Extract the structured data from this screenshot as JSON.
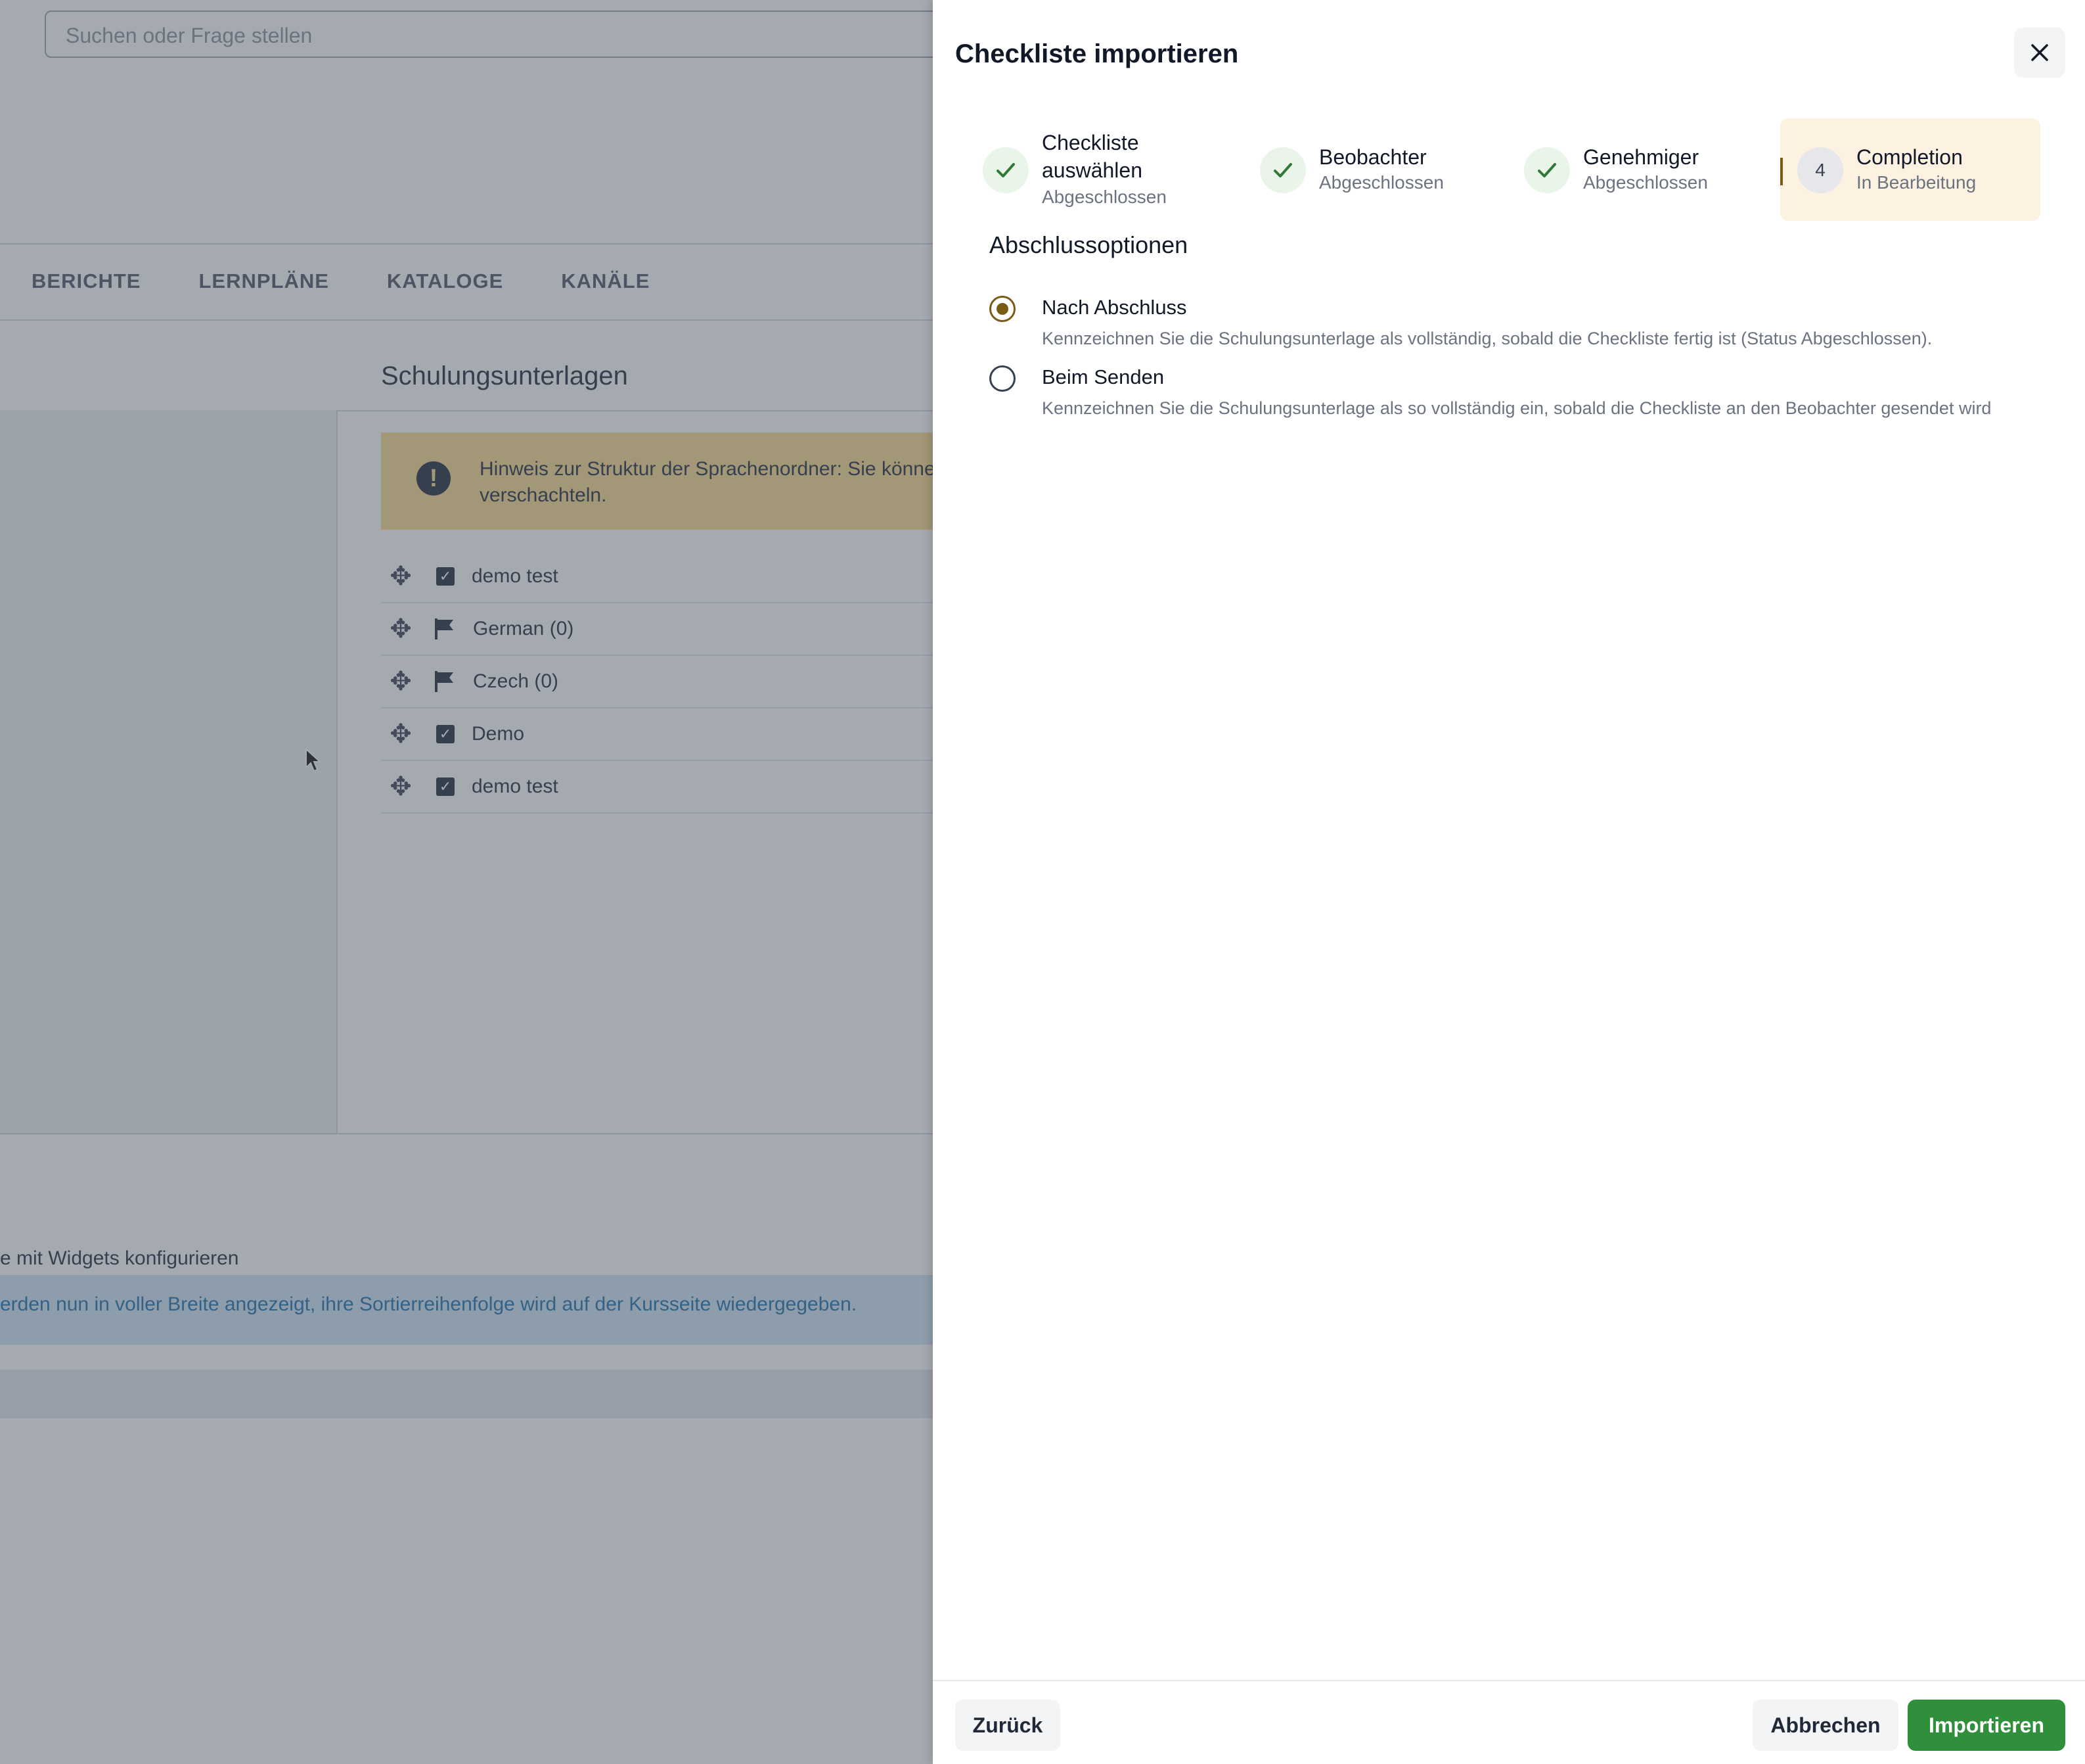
{
  "background": {
    "search_placeholder": "Suchen oder Frage stellen",
    "nav": [
      "BERICHTE",
      "LERNPLÄNE",
      "KATALOGE",
      "KANÄLE"
    ],
    "panel_title": "Schulungsunterlagen",
    "warning_text": "Hinweis zur Struktur der Sprachenordner: Sie können verschachteln.",
    "tree": [
      {
        "label": "demo test",
        "icon": "checklist-icon"
      },
      {
        "label": "German (0)",
        "icon": "flag-icon"
      },
      {
        "label": "Czech (0)",
        "icon": "flag-icon"
      },
      {
        "label": "Demo",
        "icon": "checklist-icon"
      },
      {
        "label": "demo test",
        "icon": "checklist-icon"
      }
    ],
    "widget_text": "e mit Widgets konfigurieren",
    "info_text": "erden nun in voller Breite angezeigt, ihre Sortierreihenfolge wird auf der Kursseite wiedergegeben."
  },
  "drawer": {
    "title": "Checkliste importieren",
    "steps": [
      {
        "name_line1": "Checkliste",
        "name_line2": "auswählen",
        "status": "Abgeschlossen"
      },
      {
        "name": "Beobachter",
        "status": "Abgeschlossen"
      },
      {
        "name": "Genehmiger",
        "status": "Abgeschlossen"
      },
      {
        "number": "4",
        "name": "Completion",
        "status": "In Bearbeitung"
      }
    ],
    "section_title": "Abschlussoptionen",
    "options": [
      {
        "label": "Nach Abschluss",
        "description": "Kennzeichnen Sie die Schulungsunterlage als vollständig, sobald die Checkliste fertig ist (Status Abgeschlossen).",
        "selected": true
      },
      {
        "label": "Beim Senden",
        "description": "Kennzeichnen Sie die Schulungsunterlage als so vollständig ein, sobald die Checkliste an den Beobachter gesendet wird",
        "selected": false
      }
    ],
    "buttons": {
      "back": "Zurück",
      "cancel": "Abbrechen",
      "import": "Importieren"
    }
  },
  "colors": {
    "accent_brown": "#7a5b14",
    "import_green": "#2f8f3a",
    "warning_yellow": "#f9d98b",
    "info_blue": "#cfe4f3"
  }
}
